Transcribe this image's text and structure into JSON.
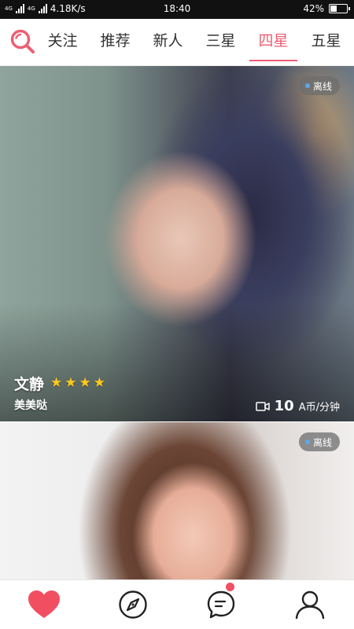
{
  "status_bar": {
    "network_label": "4G",
    "speed": "4.18K/s",
    "time": "18:40",
    "battery_percent": "42%",
    "battery_level": 0.42
  },
  "tabs": [
    {
      "label": "关注",
      "active": false
    },
    {
      "label": "推荐",
      "active": false
    },
    {
      "label": "新人",
      "active": false
    },
    {
      "label": "三星",
      "active": false
    },
    {
      "label": "四星",
      "active": true
    },
    {
      "label": "五星",
      "active": false
    }
  ],
  "cards": [
    {
      "status": "离线",
      "name": "文静",
      "stars": 4,
      "nickname": "美美哒",
      "price": "10",
      "price_unit": "A币/分钟"
    },
    {
      "status": "离线"
    }
  ],
  "colors": {
    "accent": "#ee5d72",
    "star": "#ffc81f",
    "nav_heart": "#f24e62"
  },
  "bottom_nav": [
    {
      "icon": "heart-icon",
      "active": true
    },
    {
      "icon": "compass-icon",
      "active": false
    },
    {
      "icon": "message-icon",
      "active": false,
      "has_badge": true
    },
    {
      "icon": "user-icon",
      "active": false
    }
  ]
}
